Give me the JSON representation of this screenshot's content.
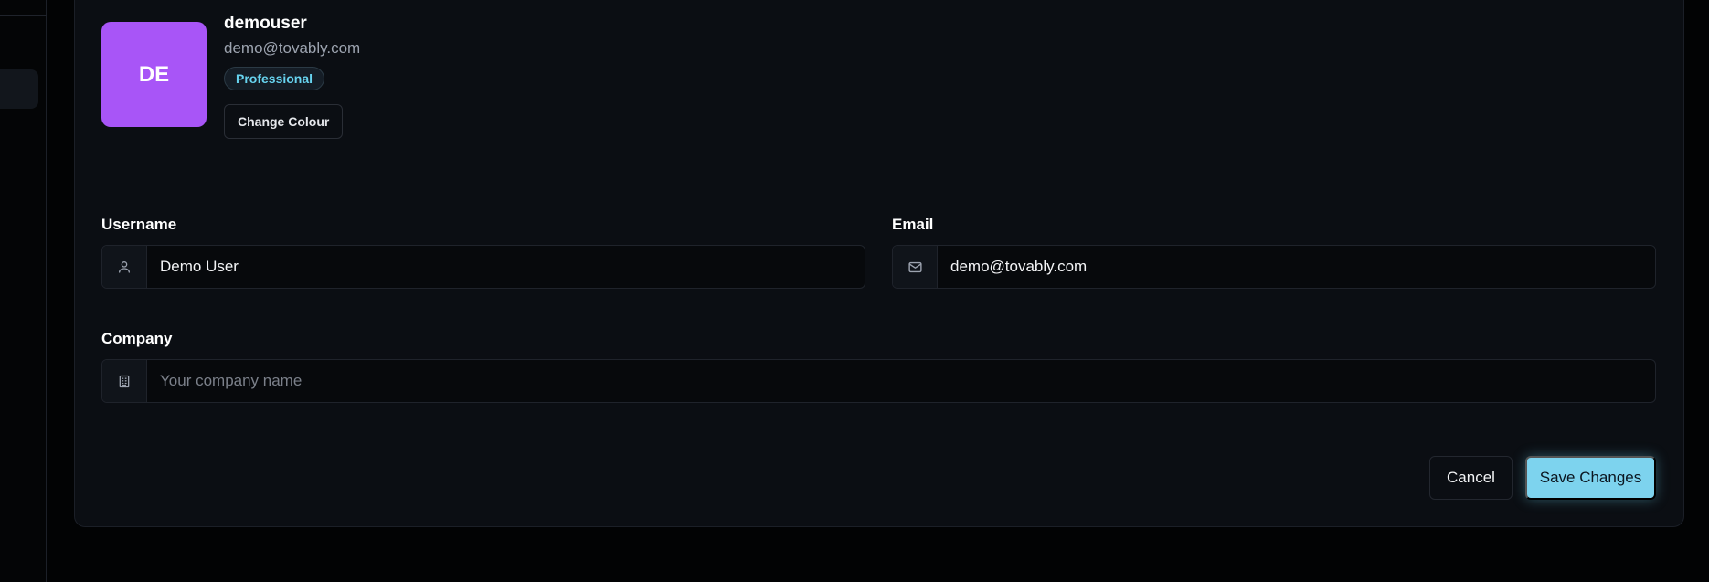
{
  "profile": {
    "avatar_initials": "DE",
    "avatar_color": "#a855f7",
    "username": "demouser",
    "email": "demo@tovably.com",
    "plan_badge": "Professional",
    "change_colour_label": "Change Colour"
  },
  "form": {
    "username": {
      "label": "Username",
      "value": "Demo User",
      "icon": "user-icon"
    },
    "email": {
      "label": "Email",
      "value": "demo@tovably.com",
      "icon": "mail-icon"
    },
    "company": {
      "label": "Company",
      "value": "",
      "placeholder": "Your company name",
      "icon": "building-icon"
    }
  },
  "actions": {
    "cancel_label": "Cancel",
    "save_label": "Save Changes"
  },
  "colors": {
    "accent": "#7dd3ee",
    "badge_text": "#67d3ef",
    "background": "#0b0e13"
  }
}
